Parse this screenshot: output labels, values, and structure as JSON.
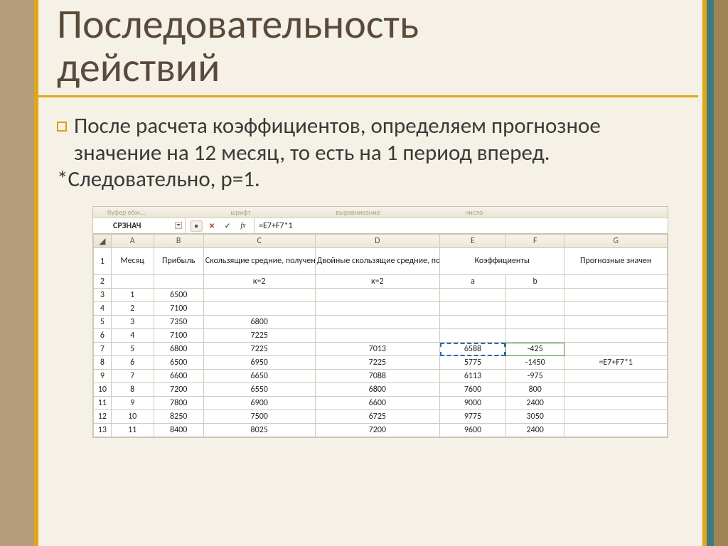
{
  "title_line1": "Последовательность",
  "title_line2": "действий",
  "body_text": "После расчета коэффициентов, определяем прогнозное значение на 12 месяц, то есть на 1 период вперед.",
  "note_text": "*Следовательно, p=1.",
  "excel": {
    "ribbon_labels": [
      "буфер обм...",
      "шрифт",
      "выравнивание",
      "число"
    ],
    "name_box": "СРЗНАЧ",
    "fx_label": "fx",
    "formula": "=E7+F7*1",
    "col_headers": [
      "A",
      "B",
      "C",
      "D",
      "E",
      "F",
      "G"
    ],
    "row_headers": [
      "1",
      "2",
      "3",
      "4",
      "5",
      "6",
      "7",
      "8",
      "9",
      "10",
      "11",
      "12",
      "13"
    ],
    "header_row1": {
      "A": "Месяц",
      "B": "Прибыль",
      "C": "Скользящие средние, полученные с",
      "D": "Двойные скользящие средние, полученные с",
      "EF": "Коэффициенты",
      "G": "Прогнозные значен"
    },
    "header_row2": {
      "C": "к=2",
      "D": "к=2",
      "E": "a",
      "F": "b"
    },
    "rows": [
      {
        "n": "1",
        "A": "1",
        "B": "6500",
        "C": "",
        "D": "",
        "E": "",
        "F": "",
        "G": ""
      },
      {
        "n": "2",
        "A": "2",
        "B": "7100",
        "C": "",
        "D": "",
        "E": "",
        "F": "",
        "G": ""
      },
      {
        "n": "3",
        "A": "3",
        "B": "7350",
        "C": "6800",
        "D": "",
        "E": "",
        "F": "",
        "G": ""
      },
      {
        "n": "4",
        "A": "4",
        "B": "7100",
        "C": "7225",
        "D": "",
        "E": "",
        "F": "",
        "G": ""
      },
      {
        "n": "5",
        "A": "5",
        "B": "6800",
        "C": "7225",
        "D": "7013",
        "E": "6588",
        "F": "-425",
        "G": ""
      },
      {
        "n": "6",
        "A": "6",
        "B": "6500",
        "C": "6950",
        "D": "7225",
        "E": "5775",
        "F": "-1450",
        "G": "=E7+F7*1"
      },
      {
        "n": "7",
        "A": "7",
        "B": "6600",
        "C": "6650",
        "D": "7088",
        "E": "6113",
        "F": "-975",
        "G": ""
      },
      {
        "n": "8",
        "A": "8",
        "B": "7200",
        "C": "6550",
        "D": "6800",
        "E": "7600",
        "F": "800",
        "G": ""
      },
      {
        "n": "9",
        "A": "9",
        "B": "7800",
        "C": "6900",
        "D": "6600",
        "E": "9000",
        "F": "2400",
        "G": ""
      },
      {
        "n": "10",
        "A": "10",
        "B": "8250",
        "C": "7500",
        "D": "6725",
        "E": "9775",
        "F": "3050",
        "G": ""
      },
      {
        "n": "11",
        "A": "11",
        "B": "8400",
        "C": "8025",
        "D": "7200",
        "E": "9600",
        "F": "2400",
        "G": ""
      }
    ]
  }
}
